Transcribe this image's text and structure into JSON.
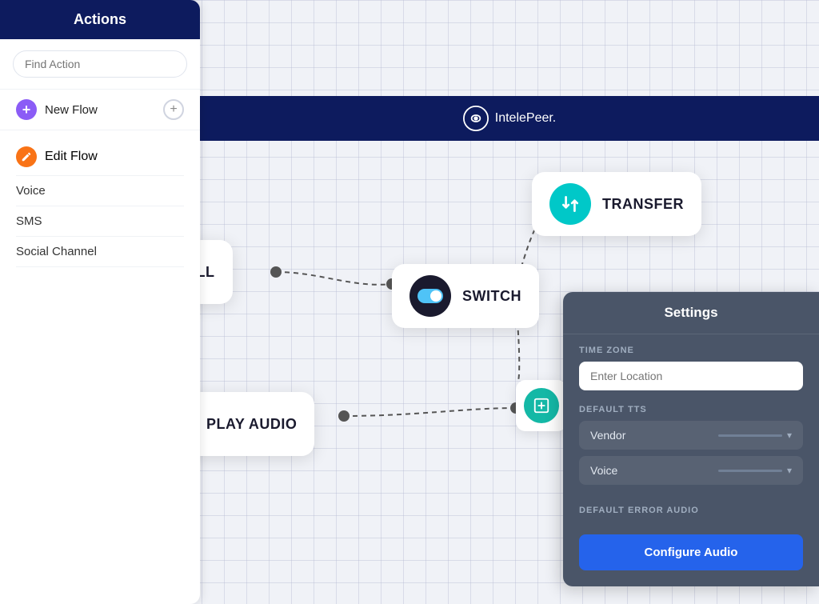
{
  "sidebar": {
    "header": "Actions",
    "search_placeholder": "Find Action",
    "new_flow_label": "New Flow",
    "new_flow_plus": "+",
    "edit_flow_label": "Edit Flow",
    "menu_items": [
      "Voice",
      "SMS",
      "Social Channel"
    ]
  },
  "header": {
    "logo_text": "IntelePeer.",
    "logo_icon": "℗"
  },
  "nodes": {
    "icall": {
      "label": "ICALL"
    },
    "play_audio": {
      "label": "PLAY AUDIO"
    },
    "switch": {
      "label": "SWITCH"
    },
    "transfer": {
      "label": "TRANSFER"
    }
  },
  "settings": {
    "title": "Settings",
    "timezone_label": "TIME ZONE",
    "timezone_placeholder": "Enter Location",
    "default_tts_label": "DEFAULT TTS",
    "vendor_label": "Vendor",
    "voice_label": "Voice",
    "error_audio_label": "DEFAULT ERROR AUDIO",
    "configure_btn": "Configure Audio"
  }
}
